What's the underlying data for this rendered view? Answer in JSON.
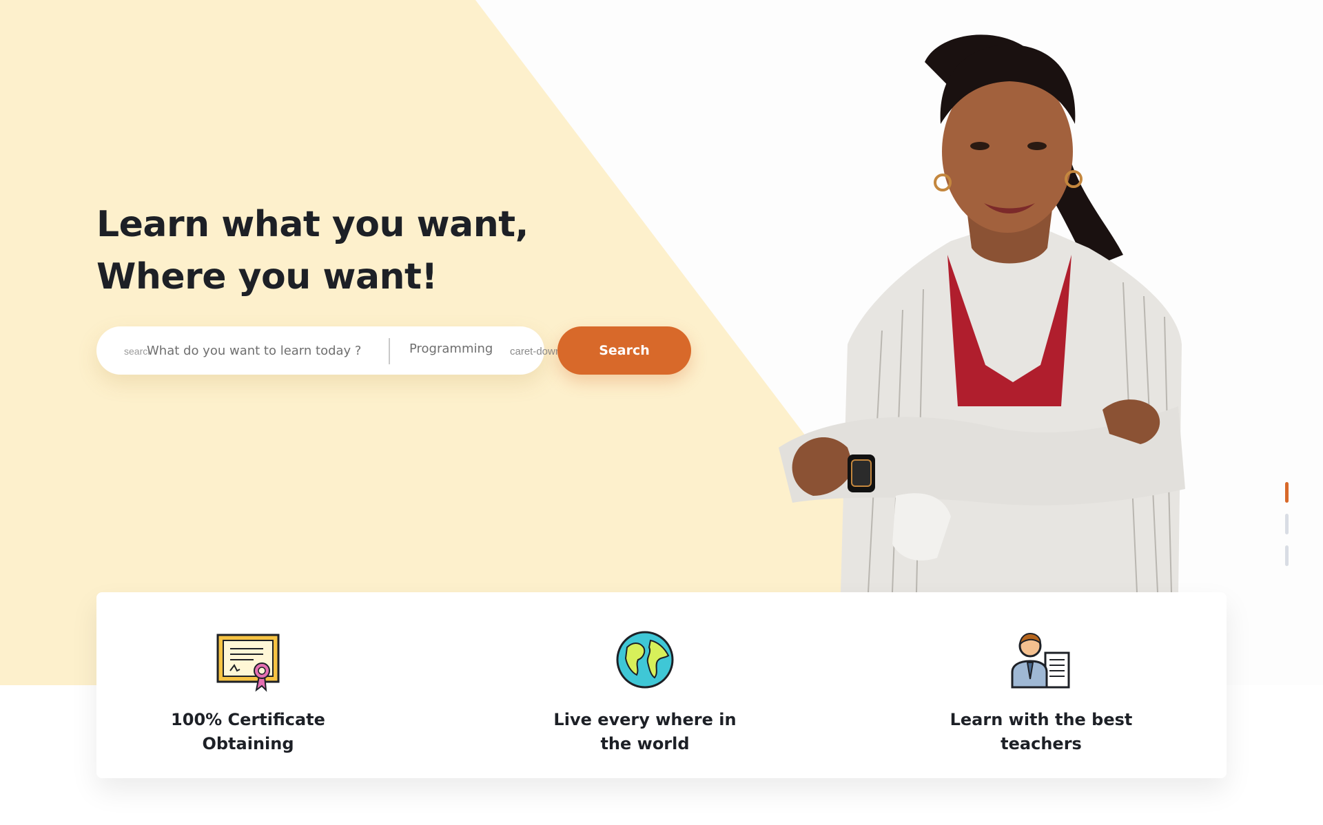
{
  "hero": {
    "title_line1": "Learn what you want,",
    "title_line2": "Where you want!"
  },
  "search": {
    "icon_label": "search",
    "placeholder": "What do you want to learn today ?",
    "category": "Programming",
    "caret_label": "caret-down",
    "button_label": "Search"
  },
  "features": [
    {
      "icon": "certificate-icon",
      "label_line1": "100% Certificate",
      "label_line2": "Obtaining"
    },
    {
      "icon": "globe-icon",
      "label_line1": "Live every where in",
      "label_line2": "the world"
    },
    {
      "icon": "teacher-icon",
      "label_line1": "Learn with the best",
      "label_line2": "teachers"
    }
  ],
  "slider": {
    "count": 3,
    "active_index": 0
  },
  "colors": {
    "hero_background": "#fdf0cc",
    "accent": "#d8692a",
    "text": "#1d2026"
  }
}
